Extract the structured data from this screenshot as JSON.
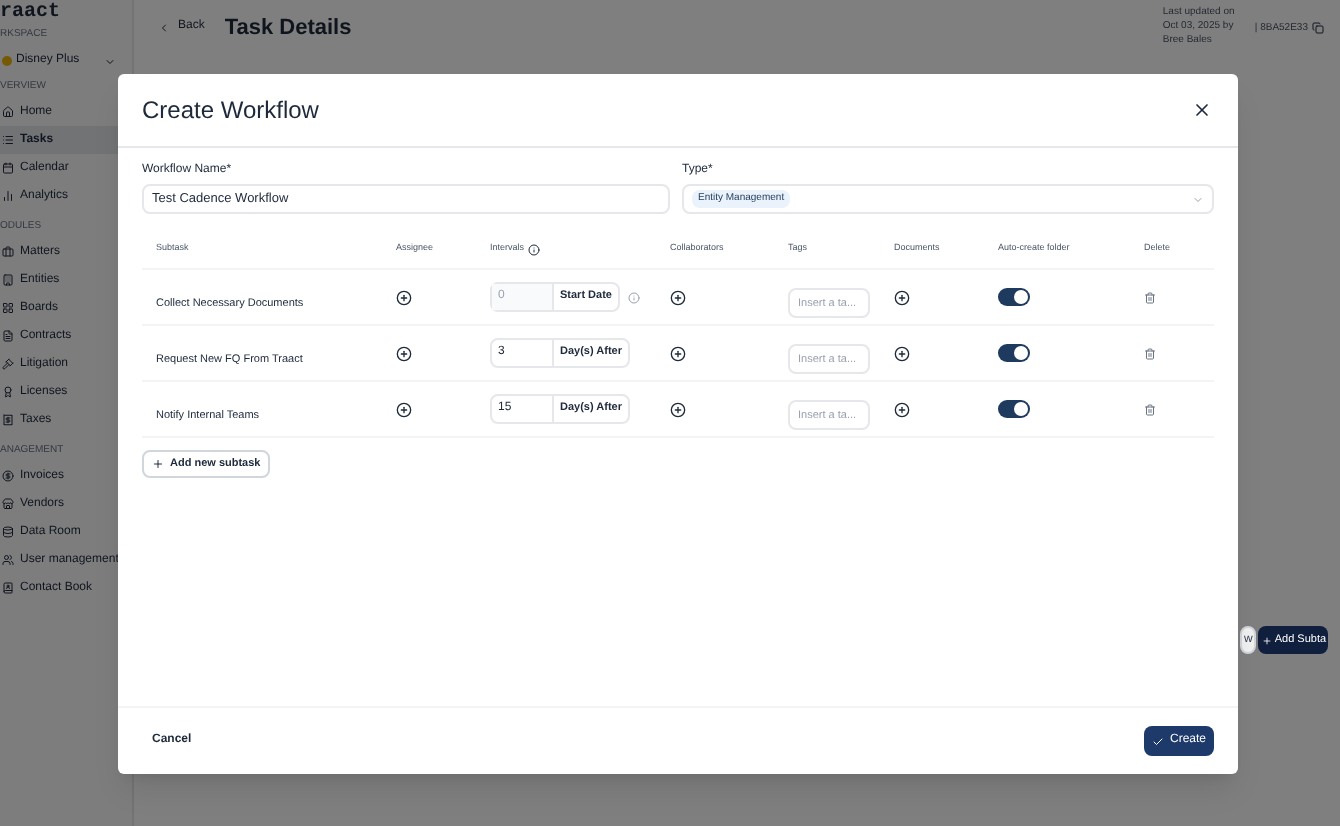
{
  "sidebar": {
    "logo": "raact",
    "workspace_label": "RKSPACE",
    "workspace": "Disney Plus",
    "sections": [
      {
        "title": "VERVIEW",
        "items": [
          {
            "label": "Home",
            "selected": false
          },
          {
            "label": "Tasks",
            "selected": true
          },
          {
            "label": "Calendar",
            "selected": false
          },
          {
            "label": "Analytics",
            "selected": false
          }
        ]
      },
      {
        "title": "ODULES",
        "items": [
          {
            "label": "Matters",
            "selected": false
          },
          {
            "label": "Entities",
            "selected": false
          },
          {
            "label": "Boards",
            "selected": false
          },
          {
            "label": "Contracts",
            "selected": false
          },
          {
            "label": "Litigation",
            "selected": false
          },
          {
            "label": "Licenses",
            "selected": false
          },
          {
            "label": "Taxes",
            "selected": false
          }
        ]
      },
      {
        "title": "ANAGEMENT",
        "items": [
          {
            "label": "Invoices",
            "selected": false
          },
          {
            "label": "Vendors",
            "selected": false
          },
          {
            "label": "Data Room",
            "selected": false
          },
          {
            "label": "User management",
            "selected": false
          },
          {
            "label": "Contact Book",
            "selected": false
          }
        ]
      }
    ]
  },
  "header": {
    "back": "Back",
    "title": "Task Details",
    "updated": "Last updated on Oct 03, 2025 by Bree Bales",
    "id": "| 8BA52E33"
  },
  "page_buttons": [
    "w",
    "Add Subta"
  ],
  "modal": {
    "title": "Create Workflow",
    "workflow_name": {
      "label": "Workflow Name*",
      "value": "Test Cadence Workflow"
    },
    "type": {
      "label": "Type*",
      "value": "Entity Management"
    },
    "columns": [
      "Subtask",
      "Assignee",
      "Intervals",
      "Collaborators",
      "Tags",
      "Documents",
      "Auto-create folder",
      "Delete"
    ],
    "rows": [
      {
        "subtask": "Collect Necessary Documents",
        "interval": "0",
        "unit": "Start Date",
        "disabled": true,
        "info_icon": true,
        "tags_placeholder": "Insert a ta...",
        "auto_create_folder": true
      },
      {
        "subtask": "Request New FQ From Traact",
        "interval": "3",
        "unit": "Day(s) After",
        "disabled": false,
        "info_icon": false,
        "tags_placeholder": "Insert a ta...",
        "auto_create_folder": true
      },
      {
        "subtask": "Notify Internal Teams",
        "interval": "15",
        "unit": "Day(s) After",
        "disabled": false,
        "info_icon": false,
        "tags_placeholder": "Insert a ta...",
        "auto_create_folder": true
      }
    ],
    "add_subtask": "Add new subtask",
    "cancel": "Cancel",
    "create": "Create"
  }
}
